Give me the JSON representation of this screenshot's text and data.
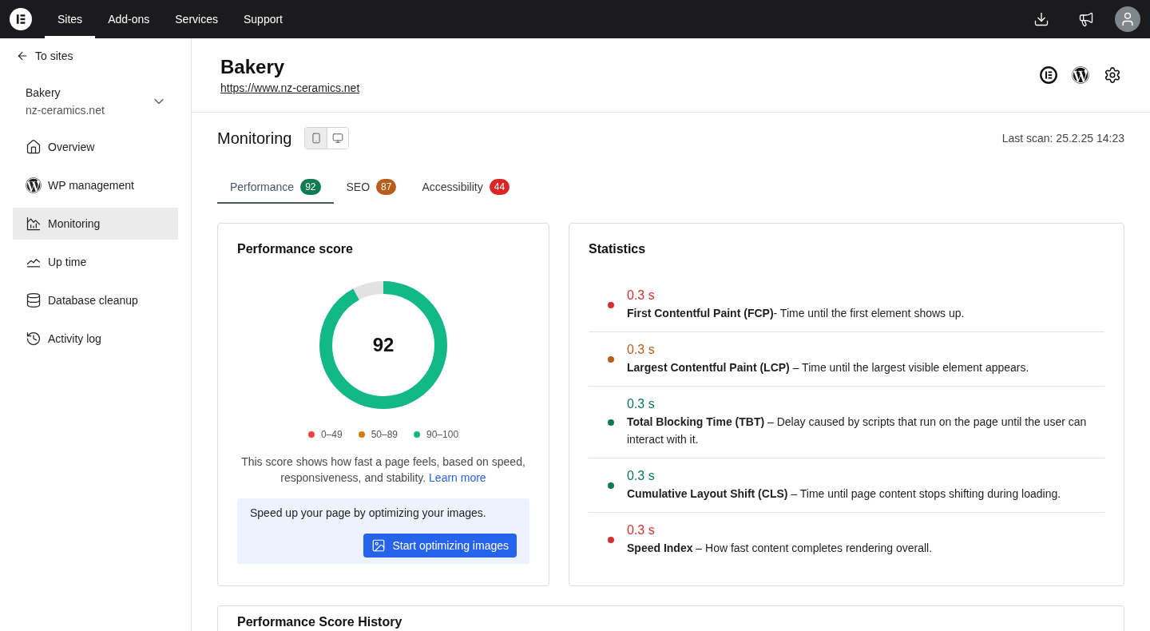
{
  "top_nav": {
    "items": [
      {
        "label": "Sites",
        "selected": true
      },
      {
        "label": "Add-ons",
        "selected": false
      },
      {
        "label": "Services",
        "selected": false
      },
      {
        "label": "Support",
        "selected": false
      }
    ]
  },
  "sidebar": {
    "back_link": "To sites",
    "site": {
      "name": "Bakery",
      "domain": "nz-ceramics.net"
    },
    "items": [
      {
        "label": "Overview",
        "selected": false
      },
      {
        "label": "WP management",
        "selected": false
      },
      {
        "label": "Monitoring",
        "selected": true
      },
      {
        "label": "Up time",
        "selected": false
      },
      {
        "label": "Database cleanup",
        "selected": false
      },
      {
        "label": "Activity log",
        "selected": false
      }
    ]
  },
  "header": {
    "title": "Bakery",
    "url": "https://www.nz-ceramics.net"
  },
  "monitoring": {
    "title": "Monitoring",
    "views": [
      {
        "kind": "mobile",
        "selected": true
      },
      {
        "kind": "desktop",
        "selected": false
      }
    ],
    "last_scan": "Last scan: 25.2.25 14:23",
    "tabs": [
      {
        "label": "Performance",
        "badge": "92",
        "color": "#0e7c52",
        "selected": true
      },
      {
        "label": "SEO",
        "badge": "87",
        "color": "#b95c1c",
        "selected": false
      },
      {
        "label": "Accessibility",
        "badge": "44",
        "color": "#dc2626",
        "selected": false
      }
    ]
  },
  "performance_score": {
    "title": "Performance score",
    "score": "92",
    "level": 0.92,
    "legend": [
      {
        "label": "0–49",
        "color": "#ef4444"
      },
      {
        "label": "50–89",
        "color": "#d97706"
      },
      {
        "label": "90–100",
        "color": "#10b981"
      }
    ],
    "description": "This score shows how fast a page feels, based on speed, responsiveness, and stability.",
    "learn_more": "Learn more",
    "tip": {
      "text": "Speed up your page by optimizing your images.",
      "button": "Start optimizing images"
    }
  },
  "statistics": {
    "title": "Statistics",
    "items": [
      {
        "value": "0.3 s",
        "description": "**First Contentful Paint (FCP)**- Time until the first element shows up.",
        "color": "#d32f2f"
      },
      {
        "value": "0.3 s",
        "description": "**Largest Contentful Paint (LCP)** – Time until the largest visible element appears.",
        "color": "#b95c1c"
      },
      {
        "value": "0.3 s",
        "description": "**Total Blocking Time (TBT)** – Delay caused by scripts that run on the page until the user can interact with it.",
        "color": "#0b7a50"
      },
      {
        "value": "0.3 s",
        "description": "**Cumulative Layout Shift (CLS)** – Time until page content stops shifting during loading.",
        "color": "#0b7a50"
      },
      {
        "value": "0.3 s",
        "description": "**Speed Index** – How fast content completes rendering overall.",
        "color": "#d32f2f"
      }
    ]
  },
  "history": {
    "title": "Performance Score History"
  }
}
